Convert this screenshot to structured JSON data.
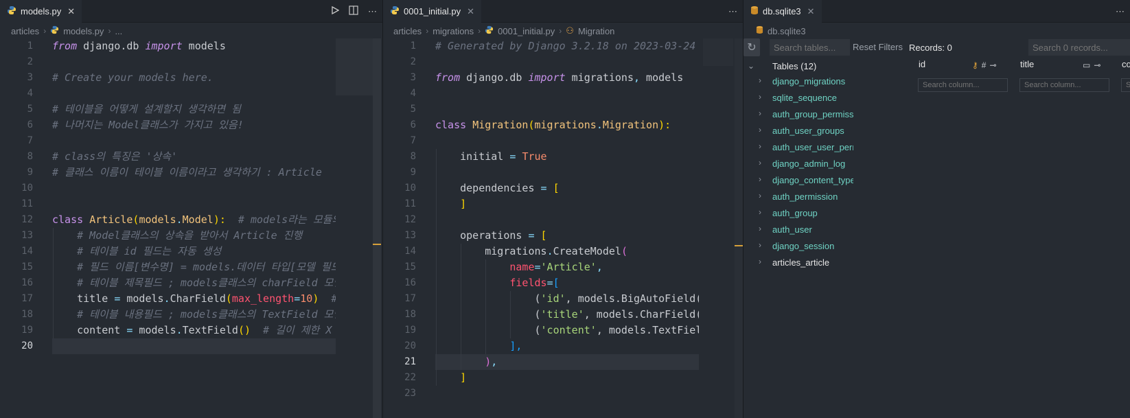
{
  "panes": {
    "models": {
      "tab_label": "models.py",
      "breadcrumb": [
        "articles",
        "models.py",
        "..."
      ],
      "lines": [
        {
          "n": "1",
          "tokens": [
            [
              "from",
              "kw"
            ],
            [
              " django.db ",
              ""
            ],
            [
              "import",
              "kw"
            ],
            [
              " models",
              ""
            ]
          ]
        },
        {
          "n": "2",
          "tokens": []
        },
        {
          "n": "3",
          "tokens": [
            [
              "# Create your models here.",
              "cm"
            ]
          ]
        },
        {
          "n": "4",
          "tokens": []
        },
        {
          "n": "5",
          "tokens": [
            [
              "# 테이블을 어떻게 설계할지 생각하면 됨",
              "cm"
            ]
          ]
        },
        {
          "n": "6",
          "tokens": [
            [
              "# 나머지는 Model클래스가 가지고 있음!",
              "cm"
            ]
          ]
        },
        {
          "n": "7",
          "tokens": []
        },
        {
          "n": "8",
          "tokens": [
            [
              "# class의 특징은 '상속'",
              "cm"
            ]
          ]
        },
        {
          "n": "9",
          "tokens": [
            [
              "# 클래스 이름이 테이블 이름이라고 생각하기 : Article",
              "cm"
            ]
          ]
        },
        {
          "n": "10",
          "tokens": []
        },
        {
          "n": "11",
          "tokens": []
        },
        {
          "n": "12",
          "tokens": [
            [
              "class",
              "kw2"
            ],
            [
              " ",
              ""
            ],
            [
              "Article",
              "cls"
            ],
            [
              "(",
              "par"
            ],
            [
              "models",
              "cls"
            ],
            [
              ".",
              "op"
            ],
            [
              "Model",
              "cls"
            ],
            [
              "):",
              "par"
            ],
            [
              "  # models라는 모듈의",
              "cm"
            ]
          ]
        },
        {
          "n": "13",
          "tokens": [
            [
              "    # Model클래스의 상속을 받아서 Article 진행",
              "cm"
            ]
          ]
        },
        {
          "n": "14",
          "tokens": [
            [
              "    # 테이블 id 필드는 자동 생성",
              "cm"
            ]
          ]
        },
        {
          "n": "15",
          "tokens": [
            [
              "    # 필드 이름[변수명] = models.데이터 타입[모델 필드",
              "cm"
            ]
          ]
        },
        {
          "n": "16",
          "tokens": [
            [
              "    # 테이블 제목필드 ; models클래스의 charField 모델",
              "cm"
            ]
          ]
        },
        {
          "n": "17",
          "tokens": [
            [
              "    title ",
              ""
            ],
            [
              "=",
              "op"
            ],
            [
              " models",
              ""
            ],
            [
              ".",
              "op"
            ],
            [
              "CharField",
              ""
            ],
            [
              "(",
              "par"
            ],
            [
              "max_length",
              "arg"
            ],
            [
              "=",
              "op"
            ],
            [
              "10",
              "num"
            ],
            [
              ")",
              "par"
            ],
            [
              "  #",
              "cm"
            ]
          ]
        },
        {
          "n": "18",
          "tokens": [
            [
              "    # 테이블 내용필드 ; models클래스의 TextField 모델",
              "cm"
            ]
          ]
        },
        {
          "n": "19",
          "tokens": [
            [
              "    content ",
              ""
            ],
            [
              "=",
              "op"
            ],
            [
              " models",
              ""
            ],
            [
              ".",
              "op"
            ],
            [
              "TextField",
              ""
            ],
            [
              "()",
              "par"
            ],
            [
              "  # 길이 제한 X",
              "cm"
            ]
          ]
        },
        {
          "n": "20",
          "tokens": [],
          "current": true
        }
      ]
    },
    "migration": {
      "tab_label": "0001_initial.py",
      "breadcrumb": [
        "articles",
        "migrations",
        "0001_initial.py",
        "Migration"
      ],
      "lines": [
        {
          "n": "1",
          "tokens": [
            [
              "# Generated by Django 3.2.18 on 2023-03-24",
              "cm"
            ]
          ]
        },
        {
          "n": "2",
          "tokens": []
        },
        {
          "n": "3",
          "tokens": [
            [
              "from",
              "kw"
            ],
            [
              " django.db ",
              ""
            ],
            [
              "import",
              "kw"
            ],
            [
              " migrations",
              ""
            ],
            [
              ",",
              "op"
            ],
            [
              " models",
              ""
            ]
          ]
        },
        {
          "n": "4",
          "tokens": []
        },
        {
          "n": "5",
          "tokens": []
        },
        {
          "n": "6",
          "tokens": [
            [
              "class",
              "kw2"
            ],
            [
              " ",
              ""
            ],
            [
              "Migration",
              "cls"
            ],
            [
              "(",
              "par"
            ],
            [
              "migrations",
              "cls"
            ],
            [
              ".",
              "op"
            ],
            [
              "Migration",
              "cls"
            ],
            [
              "):",
              "par"
            ]
          ]
        },
        {
          "n": "7",
          "tokens": []
        },
        {
          "n": "8",
          "tokens": [
            [
              "    initial ",
              ""
            ],
            [
              "=",
              "op"
            ],
            [
              " ",
              ""
            ],
            [
              "True",
              "const"
            ]
          ]
        },
        {
          "n": "9",
          "tokens": []
        },
        {
          "n": "10",
          "tokens": [
            [
              "    dependencies ",
              ""
            ],
            [
              "=",
              "op"
            ],
            [
              " ",
              ""
            ],
            [
              "[",
              "par"
            ]
          ]
        },
        {
          "n": "11",
          "tokens": [
            [
              "    ",
              ""
            ],
            [
              "]",
              "par"
            ]
          ]
        },
        {
          "n": "12",
          "tokens": []
        },
        {
          "n": "13",
          "tokens": [
            [
              "    operations ",
              ""
            ],
            [
              "=",
              "op"
            ],
            [
              " ",
              ""
            ],
            [
              "[",
              "par"
            ]
          ]
        },
        {
          "n": "14",
          "tokens": [
            [
              "        migrations",
              ""
            ],
            [
              ".",
              "op"
            ],
            [
              "CreateModel",
              ""
            ],
            [
              "(",
              "par2"
            ]
          ]
        },
        {
          "n": "15",
          "tokens": [
            [
              "            ",
              ""
            ],
            [
              "name",
              "arg"
            ],
            [
              "=",
              "op"
            ],
            [
              "'Article'",
              "str"
            ],
            [
              ",",
              "op"
            ]
          ]
        },
        {
          "n": "16",
          "tokens": [
            [
              "            ",
              ""
            ],
            [
              "fields",
              "arg"
            ],
            [
              "=",
              "op"
            ],
            [
              "[",
              "par3"
            ]
          ]
        },
        {
          "n": "17",
          "tokens": [
            [
              "                (",
              ""
            ],
            [
              "'id'",
              "str"
            ],
            [
              ", models.BigAutoField(",
              ""
            ]
          ]
        },
        {
          "n": "18",
          "tokens": [
            [
              "                (",
              ""
            ],
            [
              "'title'",
              "str"
            ],
            [
              ", models.CharField(",
              ""
            ]
          ]
        },
        {
          "n": "19",
          "tokens": [
            [
              "                (",
              ""
            ],
            [
              "'content'",
              "str"
            ],
            [
              ", models.TextFiel",
              ""
            ]
          ]
        },
        {
          "n": "20",
          "tokens": [
            [
              "            ",
              ""
            ],
            [
              "],",
              "par3"
            ]
          ]
        },
        {
          "n": "21",
          "tokens": [
            [
              "        ",
              ""
            ],
            [
              ")",
              "par2"
            ],
            [
              ",",
              "op"
            ]
          ],
          "current": true
        },
        {
          "n": "22",
          "tokens": [
            [
              "    ",
              ""
            ],
            [
              "]",
              "par"
            ]
          ]
        },
        {
          "n": "23",
          "tokens": []
        }
      ]
    },
    "sqlite": {
      "tab_label": "db.sqlite3",
      "breadcrumb": [
        "db.sqlite3"
      ],
      "search_tables_placeholder": "Search tables...",
      "reset_filters": "Reset Filters",
      "records": "Records: 0",
      "search_records_placeholder": "Search 0 records...",
      "tables_header": "Tables (12)",
      "tables": [
        "django_migrations",
        "sqlite_sequence",
        "auth_group_permissions",
        "auth_user_groups",
        "auth_user_user_permissions",
        "django_admin_log",
        "django_content_type",
        "auth_permission",
        "auth_group",
        "auth_user",
        "django_session",
        "articles_article"
      ],
      "active_table": "articles_article",
      "columns": [
        {
          "name": "id",
          "search_placeholder": "Search column..."
        },
        {
          "name": "title",
          "search_placeholder": "Search column..."
        },
        {
          "name": "co",
          "search_placeholder": "Se"
        }
      ]
    }
  },
  "colors": {
    "accent_teal": "#6fd3c4",
    "editor_bg": "#262b32",
    "scroll_marker": "#d7a13a"
  },
  "icons": [
    "python-file-icon",
    "database-icon",
    "close-icon",
    "run-icon",
    "split-editor-icon",
    "more-actions-icon",
    "refresh-icon",
    "chevron-right-icon",
    "chevron-down-icon",
    "key-icon",
    "hash-icon",
    "pin-icon",
    "text-type-icon"
  ]
}
